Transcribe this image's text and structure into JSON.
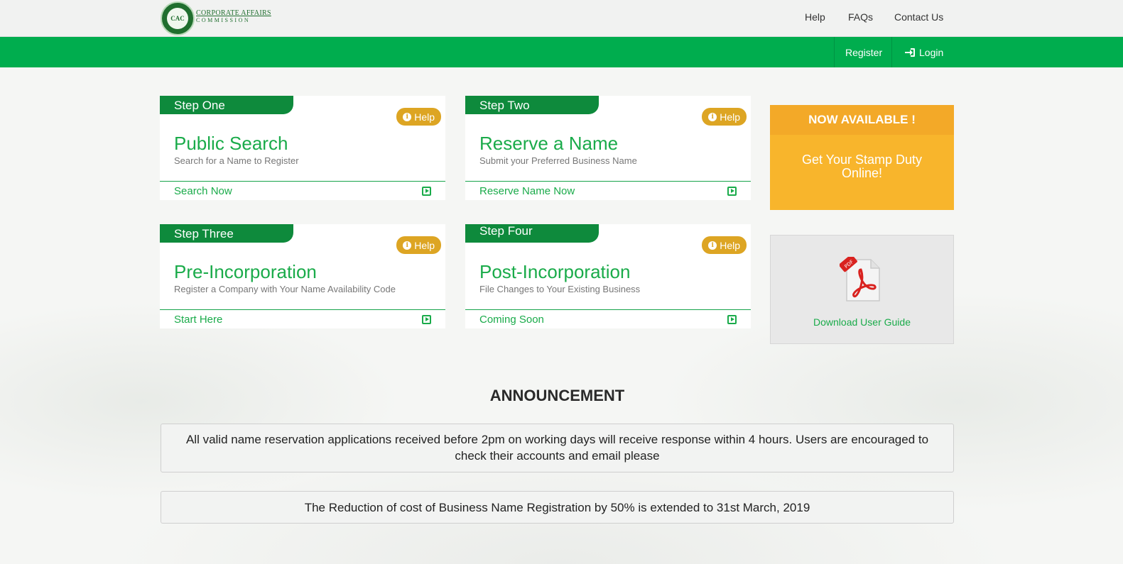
{
  "header": {
    "logo_inner": "CAC",
    "logo_line1": "CORPORATE AFFAIRS",
    "logo_line2": "COMMISSION",
    "nav": [
      "Help",
      "FAQs",
      "Contact Us"
    ]
  },
  "greenbar": {
    "register": "Register",
    "login": "Login"
  },
  "steps": [
    {
      "tab": "Step One",
      "help": "Help",
      "title": "Public Search",
      "subtitle": "Search for a Name to Register",
      "action": "Search Now"
    },
    {
      "tab": "Step Two",
      "help": "Help",
      "title": "Reserve a Name",
      "subtitle": "Submit your Preferred Business Name",
      "action": "Reserve Name Now"
    },
    {
      "tab": "Step Three",
      "help": "Help",
      "title": "Pre-Incorporation",
      "subtitle": "Register a Company with Your Name Availability Code",
      "action": "Start Here"
    },
    {
      "tab": "Step Four",
      "help": "Help",
      "title": "Post-Incorporation",
      "subtitle": "File Changes to Your Existing Business",
      "action": "Coming Soon"
    }
  ],
  "stamp": {
    "heading": "NOW AVAILABLE !",
    "body": "Get Your Stamp Duty Online!"
  },
  "guide": {
    "icon_label": "PDF",
    "link": "Download User Guide"
  },
  "announcement": {
    "title": "ANNOUNCEMENT",
    "items": [
      "All valid name reservation applications received before 2pm on working days will receive response within 4 hours. Users are encouraged to check their accounts and email please",
      "The Reduction of cost of Business Name Registration by 50% is extended to 31st March, 2019"
    ]
  },
  "colors": {
    "green": "#00ad4e",
    "accent_text": "#1aab4a",
    "help_orange": "#dda523",
    "stamp_yellow": "#f8b52c"
  }
}
